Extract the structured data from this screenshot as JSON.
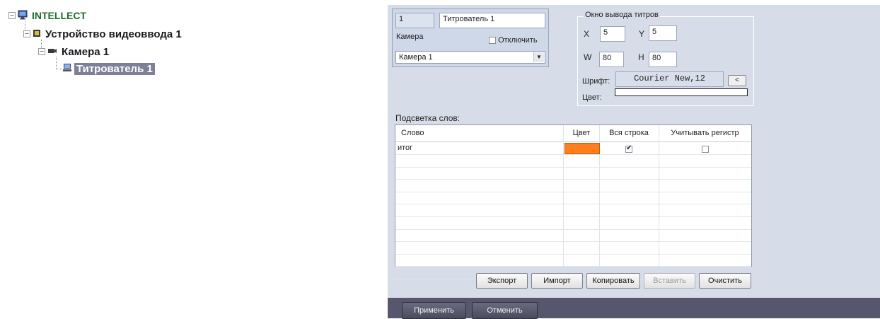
{
  "tree": {
    "root": {
      "label": "INTELLECT",
      "icon": "monitor-icon"
    },
    "device": {
      "label": "Устройство видеоввода 1",
      "icon": "video-capture-card-icon"
    },
    "camera": {
      "label": "Камера 1",
      "icon": "camera-icon"
    },
    "titler": {
      "label": "Титрователь 1",
      "icon": "titler-icon",
      "selected": true
    },
    "expander_symbol": "−"
  },
  "settings": {
    "id_value": "1",
    "name_value": "Титрователь 1",
    "camera_label": "Камера",
    "disable_label": "Отключить",
    "disable_checked": false,
    "camera_select_value": "Камера 1",
    "output_window": {
      "title": "Окно вывода титров",
      "x_label": "X",
      "x_value": "5",
      "y_label": "Y",
      "y_value": "5",
      "w_label": "W",
      "w_value": "80",
      "h_label": "H",
      "h_value": "80",
      "font_label": "Шрифт:",
      "font_value": "Courier New,12",
      "font_button": "<",
      "color_label": "Цвет:",
      "color_value": "#ffffff"
    }
  },
  "highlight": {
    "title": "Подсветка слов:",
    "columns": [
      "Слово",
      "Цвет",
      "Вся строка",
      "Учитывать регистр"
    ],
    "rows": [
      {
        "word": "итог",
        "color": "#ff7f1f",
        "whole_line": true,
        "case_sensitive": false
      }
    ],
    "empty_rows": 9
  },
  "actions": {
    "export": "Экспорт",
    "import": "Импорт",
    "copy": "Копировать",
    "paste": "Вставить",
    "clear": "Очистить"
  },
  "footer": {
    "apply": "Применить",
    "cancel": "Отменить"
  },
  "colors": {
    "panel_bg": "#d6dde9",
    "footer_bg": "#56576d",
    "selection_bg": "#7e8096",
    "root_text": "#1f6b2a"
  }
}
